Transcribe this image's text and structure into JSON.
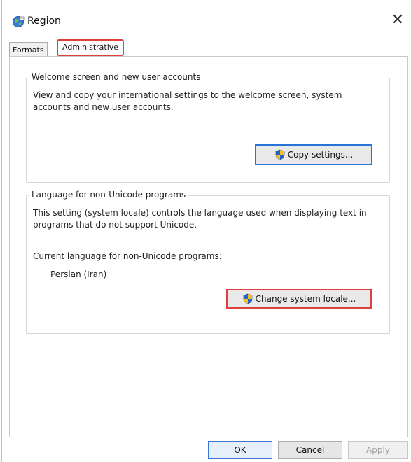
{
  "window": {
    "title": "Region",
    "close_glyph": "✕"
  },
  "tabs": [
    {
      "label": "Formats",
      "selected": false
    },
    {
      "label": "Administrative",
      "selected": true
    }
  ],
  "welcome_group": {
    "title": "Welcome screen and new user accounts",
    "description": "View and copy your international settings to the welcome screen, system accounts and new user accounts.",
    "button_label": "Copy settings..."
  },
  "language_group": {
    "title": "Language for non-Unicode programs",
    "description": "This setting (system locale) controls the language used when displaying text in programs that do not support Unicode.",
    "current_label": "Current language for non-Unicode programs:",
    "current_value": "Persian (Iran)",
    "button_label": "Change system locale..."
  },
  "footer": {
    "ok_label": "OK",
    "cancel_label": "Cancel",
    "apply_label": "Apply"
  },
  "colors": {
    "highlight": "#e04040",
    "focus": "#2673d9",
    "shield_blue": "#2a63c9",
    "shield_gold": "#f2c028"
  },
  "icons": [
    "globe-icon",
    "close-icon",
    "uac-shield-icon"
  ]
}
